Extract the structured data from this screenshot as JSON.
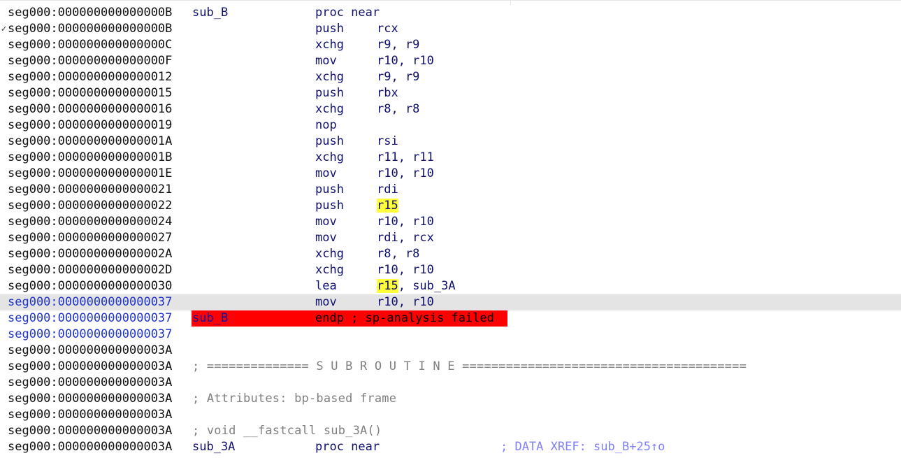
{
  "rows": [
    {
      "mark": "",
      "addr": "seg000:000000000000000B",
      "label": "sub_B",
      "mnemonic": "proc near",
      "operands": ""
    },
    {
      "mark": "✓",
      "addr": "seg000:000000000000000B",
      "label": "",
      "mnemonic": "push",
      "operands": "rcx"
    },
    {
      "mark": "",
      "addr": "seg000:000000000000000C",
      "label": "",
      "mnemonic": "xchg",
      "operands": "r9, r9"
    },
    {
      "mark": "",
      "addr": "seg000:000000000000000F",
      "label": "",
      "mnemonic": "mov",
      "operands": "r10, r10"
    },
    {
      "mark": "",
      "addr": "seg000:0000000000000012",
      "label": "",
      "mnemonic": "xchg",
      "operands": "r9, r9"
    },
    {
      "mark": "",
      "addr": "seg000:0000000000000015",
      "label": "",
      "mnemonic": "push",
      "operands": "rbx"
    },
    {
      "mark": "",
      "addr": "seg000:0000000000000016",
      "label": "",
      "mnemonic": "xchg",
      "operands": "r8, r8"
    },
    {
      "mark": "",
      "addr": "seg000:0000000000000019",
      "label": "",
      "mnemonic": "nop",
      "operands": ""
    },
    {
      "mark": "",
      "addr": "seg000:000000000000001A",
      "label": "",
      "mnemonic": "push",
      "operands": "rsi"
    },
    {
      "mark": "",
      "addr": "seg000:000000000000001B",
      "label": "",
      "mnemonic": "xchg",
      "operands": "r11, r11"
    },
    {
      "mark": "",
      "addr": "seg000:000000000000001E",
      "label": "",
      "mnemonic": "mov",
      "operands": "r10, r10"
    },
    {
      "mark": "",
      "addr": "seg000:0000000000000021",
      "label": "",
      "mnemonic": "push",
      "operands": "rdi"
    },
    {
      "mark": "",
      "addr": "seg000:0000000000000022",
      "label": "",
      "mnemonic": "push",
      "operands_hl": "r15",
      "operands_rest": ""
    },
    {
      "mark": "",
      "addr": "seg000:0000000000000024",
      "label": "",
      "mnemonic": "mov",
      "operands": "r10, r10"
    },
    {
      "mark": "",
      "addr": "seg000:0000000000000027",
      "label": "",
      "mnemonic": "mov",
      "operands": "rdi, rcx"
    },
    {
      "mark": "",
      "addr": "seg000:000000000000002A",
      "label": "",
      "mnemonic": "xchg",
      "operands": "r8, r8"
    },
    {
      "mark": "",
      "addr": "seg000:000000000000002D",
      "label": "",
      "mnemonic": "xchg",
      "operands": "r10, r10"
    },
    {
      "mark": "",
      "addr": "seg000:0000000000000030",
      "label": "",
      "mnemonic": "lea",
      "operands_hl": "r15",
      "operands_rest": ", sub_3A"
    },
    {
      "mark": "",
      "addr": "seg000:0000000000000037",
      "label": "",
      "mnemonic": "mov",
      "operands": "r10, r10",
      "current": true,
      "blue": true
    },
    {
      "addr": "seg000:0000000000000037",
      "blue": true,
      "error": true,
      "label": "sub_B",
      "text": "endp ; sp-analysis failed"
    },
    {
      "addr": "seg000:0000000000000037",
      "blue": true
    },
    {
      "addr": "seg000:000000000000003A"
    },
    {
      "addr": "seg000:000000000000003A",
      "comment": "; ============== S U B R O U T I N E ======================================="
    },
    {
      "addr": "seg000:000000000000003A"
    },
    {
      "addr": "seg000:000000000000003A",
      "comment": "; Attributes: bp-based frame"
    },
    {
      "addr": "seg000:000000000000003A"
    },
    {
      "addr": "seg000:000000000000003A",
      "comment": "; void __fastcall sub_3A()"
    },
    {
      "addr": "seg000:000000000000003A",
      "label": "sub_3A",
      "mnemonic": "proc near",
      "xref": "; DATA XREF: sub_B+25↑o"
    }
  ]
}
